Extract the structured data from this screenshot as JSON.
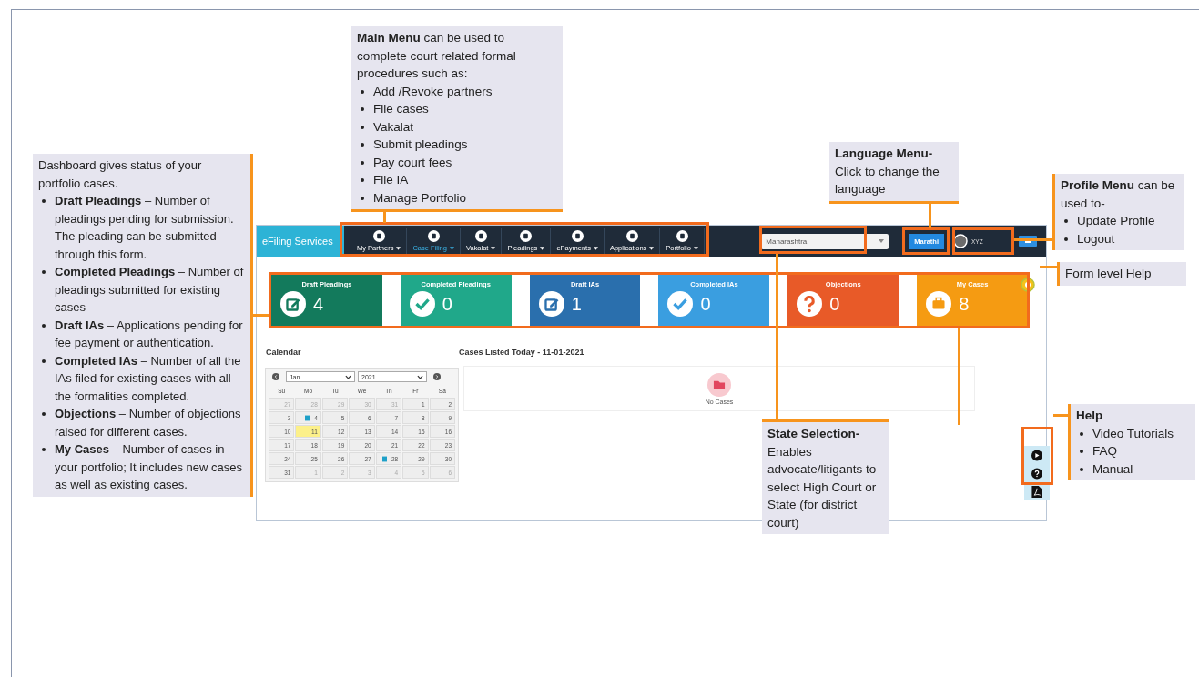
{
  "notes": [
    {
      "intro": "**Main Menu** can be used to complete court related formal procedures such as:",
      "items": [
        "Add /Revoke partners",
        "File cases",
        "Vakalat",
        "Submit pleadings",
        "Pay court fees",
        "File IA",
        "Manage Portfolio"
      ]
    },
    {
      "intro": "Dashboard gives status of your portfolio cases.",
      "items": [
        "**Draft Pleadings** – Number of pleadings pending for submission. The pleading can be submitted through this form.",
        "**Completed Pleadings** – Number of pleadings submitted for existing cases",
        "**Draft IAs** – Applications pending for fee payment or authentication.",
        "**Completed IAs** – Number of all the IAs filed for existing cases with all the formalities completed.",
        "**Objections** – Number of objections raised for different cases.",
        "**My Cases** – Number of cases in your portfolio; It includes new cases as well as existing cases."
      ]
    },
    {
      "title": "Language Menu-",
      "intro": "Click to change the language"
    },
    {
      "intro": "**Profile Menu** can be used to-",
      "items": [
        "Update Profile",
        "Logout"
      ]
    },
    {
      "intro": "Form level Help"
    },
    {
      "title": "State Selection-",
      "intro": "Enables advocate/litigants to  select High Court or State (for district court)"
    },
    {
      "title": "Help",
      "items": [
        "Video Tutorials",
        "FAQ",
        "Manual"
      ]
    }
  ],
  "app": {
    "brand": "eFiling Services",
    "nav": [
      {
        "label": "My Partners",
        "selected": false
      },
      {
        "label": "Case Filing",
        "selected": true
      },
      {
        "label": "Vakalat",
        "selected": false
      },
      {
        "label": "Pleadings",
        "selected": false
      },
      {
        "label": "ePayments",
        "selected": false
      },
      {
        "label": "Applications",
        "selected": false
      },
      {
        "label": "Portfolio",
        "selected": false
      }
    ],
    "state_select": {
      "value": "Maharashtra"
    },
    "language_button": "Marathi",
    "user": "XYZ",
    "tiles": [
      {
        "title": "Draft Pleadings",
        "count": "4",
        "color": "#137a5c",
        "kind": "edit"
      },
      {
        "title": "Completed Pleadings",
        "count": "0",
        "color": "#20a88a",
        "kind": "check"
      },
      {
        "title": "Draft IAs",
        "count": "1",
        "color": "#2a6fad",
        "kind": "edit"
      },
      {
        "title": "Completed IAs",
        "count": "0",
        "color": "#3a9ee0",
        "kind": "check"
      },
      {
        "title": "Objections",
        "count": "0",
        "color": "#e85a28",
        "kind": "question"
      },
      {
        "title": "My Cases",
        "count": "8",
        "color": "#f59b12",
        "kind": "briefcase"
      }
    ],
    "calendar": {
      "heading": "Calendar",
      "month": "Jan",
      "year": "2021",
      "weekdays": [
        "Su",
        "Mo",
        "Tu",
        "We",
        "Th",
        "Fr",
        "Sa"
      ],
      "days": [
        {
          "d": "27",
          "muted": true,
          "today": false,
          "event": false
        },
        {
          "d": "28",
          "muted": true,
          "today": false,
          "event": false
        },
        {
          "d": "29",
          "muted": true,
          "today": false,
          "event": false
        },
        {
          "d": "30",
          "muted": true,
          "today": false,
          "event": false
        },
        {
          "d": "31",
          "muted": true,
          "today": false,
          "event": false
        },
        {
          "d": "1",
          "muted": false,
          "today": false,
          "event": false
        },
        {
          "d": "2",
          "muted": false,
          "today": false,
          "event": false
        },
        {
          "d": "3",
          "muted": false,
          "today": false,
          "event": false
        },
        {
          "d": "4",
          "muted": false,
          "today": false,
          "event": true
        },
        {
          "d": "5",
          "muted": false,
          "today": false,
          "event": false
        },
        {
          "d": "6",
          "muted": false,
          "today": false,
          "event": false
        },
        {
          "d": "7",
          "muted": false,
          "today": false,
          "event": false
        },
        {
          "d": "8",
          "muted": false,
          "today": false,
          "event": false
        },
        {
          "d": "9",
          "muted": false,
          "today": false,
          "event": false
        },
        {
          "d": "10",
          "muted": false,
          "today": false,
          "event": false
        },
        {
          "d": "11",
          "muted": false,
          "today": true,
          "event": false
        },
        {
          "d": "12",
          "muted": false,
          "today": false,
          "event": false
        },
        {
          "d": "13",
          "muted": false,
          "today": false,
          "event": false
        },
        {
          "d": "14",
          "muted": false,
          "today": false,
          "event": false
        },
        {
          "d": "15",
          "muted": false,
          "today": false,
          "event": false
        },
        {
          "d": "16",
          "muted": false,
          "today": false,
          "event": false
        },
        {
          "d": "17",
          "muted": false,
          "today": false,
          "event": false
        },
        {
          "d": "18",
          "muted": false,
          "today": false,
          "event": false
        },
        {
          "d": "19",
          "muted": false,
          "today": false,
          "event": false
        },
        {
          "d": "20",
          "muted": false,
          "today": false,
          "event": false
        },
        {
          "d": "21",
          "muted": false,
          "today": false,
          "event": false
        },
        {
          "d": "22",
          "muted": false,
          "today": false,
          "event": false
        },
        {
          "d": "23",
          "muted": false,
          "today": false,
          "event": false
        },
        {
          "d": "24",
          "muted": false,
          "today": false,
          "event": false
        },
        {
          "d": "25",
          "muted": false,
          "today": false,
          "event": false
        },
        {
          "d": "26",
          "muted": false,
          "today": false,
          "event": false
        },
        {
          "d": "27",
          "muted": false,
          "today": false,
          "event": false
        },
        {
          "d": "28",
          "muted": false,
          "today": false,
          "event": true
        },
        {
          "d": "29",
          "muted": false,
          "today": false,
          "event": false
        },
        {
          "d": "30",
          "muted": false,
          "today": false,
          "event": false
        },
        {
          "d": "31",
          "muted": false,
          "today": false,
          "event": false
        },
        {
          "d": "1",
          "muted": true,
          "today": false,
          "event": false
        },
        {
          "d": "2",
          "muted": true,
          "today": false,
          "event": false
        },
        {
          "d": "3",
          "muted": true,
          "today": false,
          "event": false
        },
        {
          "d": "4",
          "muted": true,
          "today": false,
          "event": false
        },
        {
          "d": "5",
          "muted": true,
          "today": false,
          "event": false
        },
        {
          "d": "6",
          "muted": true,
          "today": false,
          "event": false
        }
      ]
    },
    "cases": {
      "heading": "Cases Listed Today - 11-01-2021",
      "empty_text": "No Cases"
    }
  }
}
